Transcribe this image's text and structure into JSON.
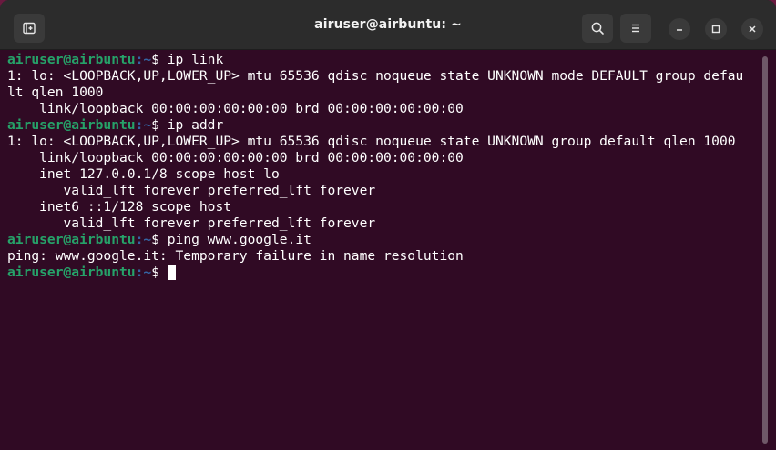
{
  "window": {
    "title": "airuser@airbuntu: ~"
  },
  "header": {
    "new_tab_icon": "new-tab-icon",
    "search_icon": "search-icon",
    "menu_icon": "hamburger-menu-icon",
    "minimize_icon": "minimize-icon",
    "maximize_icon": "maximize-icon",
    "close_icon": "close-icon"
  },
  "colors": {
    "terminal_bg": "#300a24",
    "prompt_user": "#26a269",
    "prompt_path": "#3465a4",
    "titlebar_bg": "#2c2c2c",
    "text": "#ffffff"
  },
  "prompt": {
    "user_host": "airuser@airbuntu",
    "path": ":~",
    "symbol": "$ "
  },
  "lines": [
    {
      "type": "prompt",
      "command": "ip link"
    },
    {
      "type": "output",
      "text": "1: lo: <LOOPBACK,UP,LOWER_UP> mtu 65536 qdisc noqueue state UNKNOWN mode DEFAULT group defau"
    },
    {
      "type": "output",
      "text": "lt qlen 1000"
    },
    {
      "type": "output",
      "text": "    link/loopback 00:00:00:00:00:00 brd 00:00:00:00:00:00"
    },
    {
      "type": "prompt",
      "command": "ip addr"
    },
    {
      "type": "output",
      "text": "1: lo: <LOOPBACK,UP,LOWER_UP> mtu 65536 qdisc noqueue state UNKNOWN group default qlen 1000"
    },
    {
      "type": "output",
      "text": "    link/loopback 00:00:00:00:00:00 brd 00:00:00:00:00:00"
    },
    {
      "type": "output",
      "text": "    inet 127.0.0.1/8 scope host lo"
    },
    {
      "type": "output",
      "text": "       valid_lft forever preferred_lft forever"
    },
    {
      "type": "output",
      "text": "    inet6 ::1/128 scope host"
    },
    {
      "type": "output",
      "text": "       valid_lft forever preferred_lft forever"
    },
    {
      "type": "prompt",
      "command": "ping www.google.it"
    },
    {
      "type": "output",
      "text": "ping: www.google.it: Temporary failure in name resolution"
    },
    {
      "type": "prompt",
      "command": "",
      "cursor": true
    }
  ]
}
